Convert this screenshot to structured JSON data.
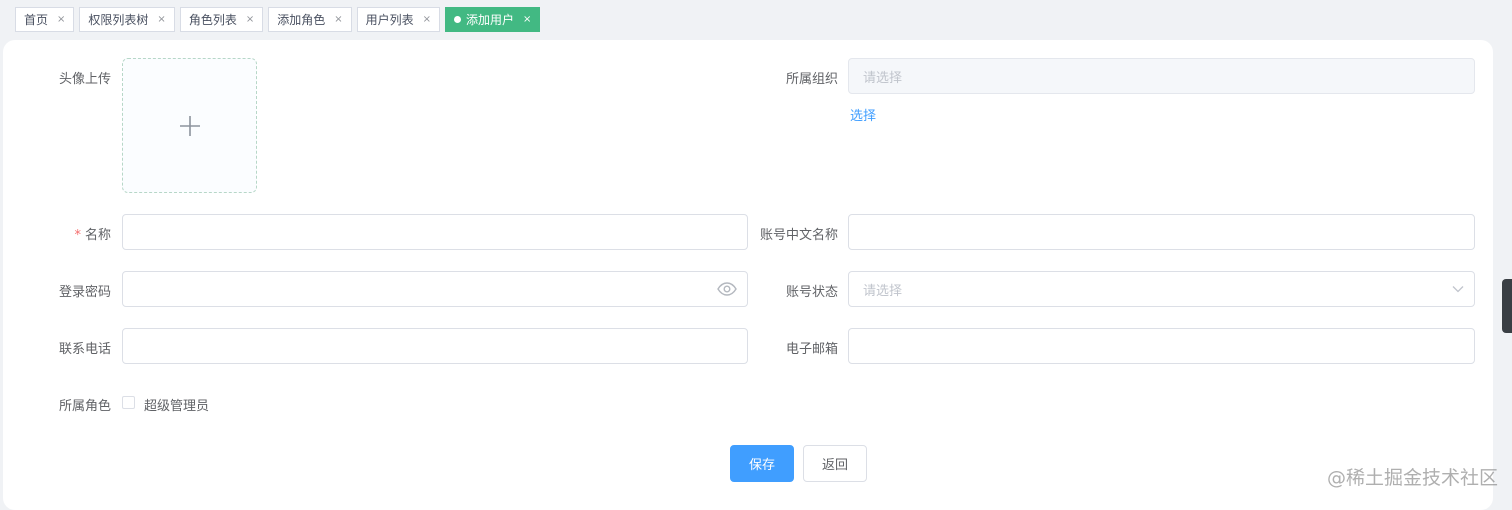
{
  "tags": [
    {
      "label": "首页",
      "active": false
    },
    {
      "label": "权限列表树",
      "active": false
    },
    {
      "label": "角色列表",
      "active": false
    },
    {
      "label": "添加角色",
      "active": false
    },
    {
      "label": "用户列表",
      "active": false
    },
    {
      "label": "添加用户",
      "active": true
    }
  ],
  "close_glyph": "×",
  "form": {
    "avatar_label": "头像上传",
    "org_label": "所属组织",
    "org_placeholder": "请选择",
    "org_select_link": "选择",
    "name_required": "*",
    "name_label": "名称",
    "cn_name_label": "账号中文名称",
    "password_label": "登录密码",
    "status_label": "账号状态",
    "status_placeholder": "请选择",
    "phone_label": "联系电话",
    "email_label": "电子邮箱",
    "role_label": "所属角色",
    "role_option": "超级管理员"
  },
  "buttons": {
    "save": "保存",
    "back": "返回"
  },
  "watermark": "@稀土掘金技术社区",
  "colors": {
    "accent": "#409eff",
    "active_tag": "#42b983",
    "required": "#f56c6c"
  }
}
